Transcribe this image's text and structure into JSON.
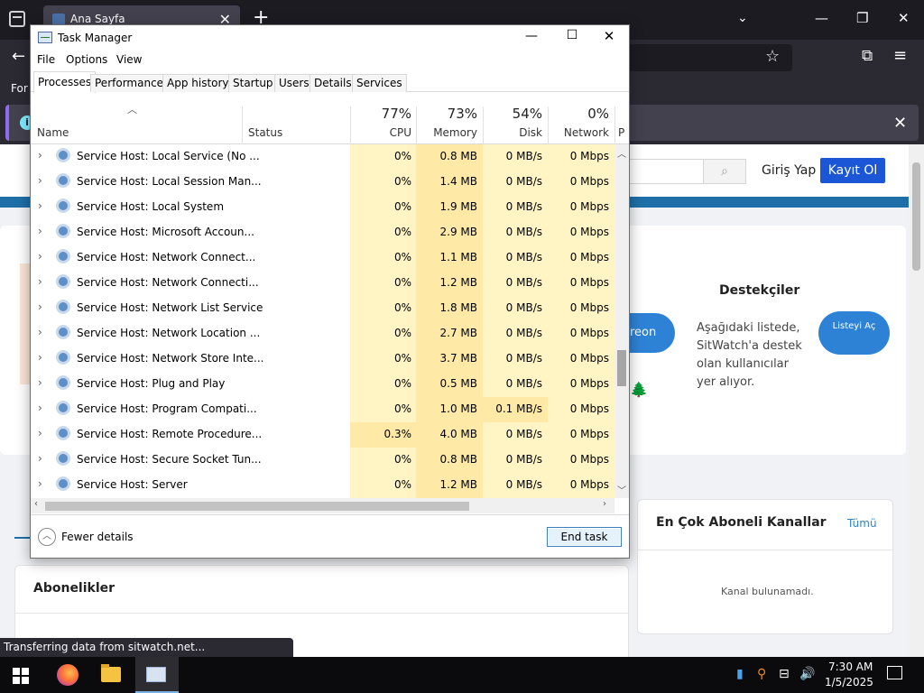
{
  "browser": {
    "tab_title": "Ana Sayfa",
    "tab_close": "✕",
    "new_tab": "+",
    "bookmarks_text": "For",
    "notice_info": "i"
  },
  "website": {
    "login": "Giriş Yap",
    "register": "Kayıt Ol",
    "patreon_fragment": "reon",
    "supporters_title": "Destekçiler",
    "supporters_desc": "Aşağıdaki listede, SitWatch'a destek olan kullanıcılar yer alıyor.",
    "list_button": "Listeyi Aç",
    "channels_title": "En Çok Aboneli Kanallar",
    "channels_all": "Tümü",
    "channels_empty": "Kanal bulunamadı.",
    "subscriptions_title": "Abonelikler",
    "status_toast": "Transferring data from sitwatch.net..."
  },
  "task_manager": {
    "title": "Task Manager",
    "menu": [
      "File",
      "Options",
      "View"
    ],
    "tabs": [
      "Processes",
      "Performance",
      "App history",
      "Startup",
      "Users",
      "Details",
      "Services"
    ],
    "active_tab": "Processes",
    "columns": {
      "name": "Name",
      "status": "Status",
      "cpu": {
        "label": "CPU",
        "pct": "77%"
      },
      "memory": {
        "label": "Memory",
        "pct": "73%"
      },
      "disk": {
        "label": "Disk",
        "pct": "54%"
      },
      "network": {
        "label": "Network",
        "pct": "0%"
      },
      "cut_column": "P"
    },
    "rows": [
      {
        "name": "Service Host: Local Service (No ...",
        "cpu": "0%",
        "memory": "0.8 MB",
        "disk": "0 MB/s",
        "network": "0 Mbps"
      },
      {
        "name": "Service Host: Local Session Man...",
        "cpu": "0%",
        "memory": "1.4 MB",
        "disk": "0 MB/s",
        "network": "0 Mbps"
      },
      {
        "name": "Service Host: Local System",
        "cpu": "0%",
        "memory": "1.9 MB",
        "disk": "0 MB/s",
        "network": "0 Mbps"
      },
      {
        "name": "Service Host: Microsoft Accoun...",
        "cpu": "0%",
        "memory": "2.9 MB",
        "disk": "0 MB/s",
        "network": "0 Mbps"
      },
      {
        "name": "Service Host: Network Connect...",
        "cpu": "0%",
        "memory": "1.1 MB",
        "disk": "0 MB/s",
        "network": "0 Mbps"
      },
      {
        "name": "Service Host: Network Connecti...",
        "cpu": "0%",
        "memory": "1.2 MB",
        "disk": "0 MB/s",
        "network": "0 Mbps"
      },
      {
        "name": "Service Host: Network List Service",
        "cpu": "0%",
        "memory": "1.8 MB",
        "disk": "0 MB/s",
        "network": "0 Mbps"
      },
      {
        "name": "Service Host: Network Location ...",
        "cpu": "0%",
        "memory": "2.7 MB",
        "disk": "0 MB/s",
        "network": "0 Mbps"
      },
      {
        "name": "Service Host: Network Store Inte...",
        "cpu": "0%",
        "memory": "3.7 MB",
        "disk": "0 MB/s",
        "network": "0 Mbps"
      },
      {
        "name": "Service Host: Plug and Play",
        "cpu": "0%",
        "memory": "0.5 MB",
        "disk": "0 MB/s",
        "network": "0 Mbps"
      },
      {
        "name": "Service Host: Program Compati...",
        "cpu": "0%",
        "memory": "1.0 MB",
        "disk": "0.1 MB/s",
        "network": "0 Mbps"
      },
      {
        "name": "Service Host: Remote Procedure...",
        "cpu": "0.3%",
        "memory": "4.0 MB",
        "disk": "0 MB/s",
        "network": "0 Mbps"
      },
      {
        "name": "Service Host: Secure Socket Tun...",
        "cpu": "0%",
        "memory": "0.8 MB",
        "disk": "0 MB/s",
        "network": "0 Mbps"
      },
      {
        "name": "Service Host: Server",
        "cpu": "0%",
        "memory": "1.2 MB",
        "disk": "0 MB/s",
        "network": "0 Mbps"
      }
    ],
    "fewer_details": "Fewer details",
    "end_task": "End task"
  },
  "taskbar": {
    "time": "7:30 AM",
    "date": "1/5/2025",
    "apps": [
      "firefox-icon",
      "file-explorer-icon",
      "task-manager-icon"
    ]
  },
  "colors": {
    "heat_light": "#fff4c4",
    "heat_medium": "#ffe9a7",
    "accent_blue": "#1a56d6",
    "end_task_border": "#3c7fc1"
  }
}
